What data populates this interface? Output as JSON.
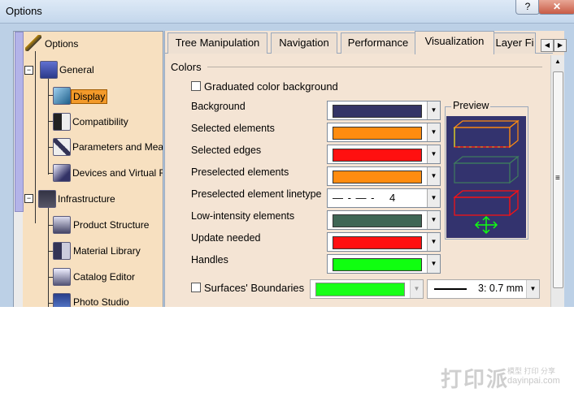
{
  "window": {
    "title": "Options",
    "help_label": "?",
    "close_label": "✕"
  },
  "tree": {
    "items": [
      {
        "label": "Options",
        "icon": "options-icon"
      },
      {
        "label": "General",
        "icon": "general-icon"
      },
      {
        "label": "Display",
        "icon": "display-icon",
        "selected": true
      },
      {
        "label": "Compatibility",
        "icon": "compatibility-icon"
      },
      {
        "label": "Parameters and Meas",
        "icon": "parameters-icon"
      },
      {
        "label": "Devices and Virtual R",
        "icon": "devices-icon"
      },
      {
        "label": "Infrastructure",
        "icon": "infrastructure-icon"
      },
      {
        "label": "Product Structure",
        "icon": "product-structure-icon"
      },
      {
        "label": "Material Library",
        "icon": "material-library-icon"
      },
      {
        "label": "Catalog Editor",
        "icon": "catalog-editor-icon"
      },
      {
        "label": "Photo Studio",
        "icon": "photo-studio-icon"
      }
    ]
  },
  "tabs": [
    {
      "label": "Tree Manipulation"
    },
    {
      "label": "Navigation"
    },
    {
      "label": "Performance"
    },
    {
      "label": "Visualization",
      "active": true
    },
    {
      "label": "Layer Fi"
    }
  ],
  "colors": {
    "section_label": "Colors",
    "graduated_label": "Graduated color background",
    "graduated_checked": false,
    "rows": [
      {
        "label": "Background",
        "color": "#343466"
      },
      {
        "label": "Selected elements",
        "color": "#ff8c10"
      },
      {
        "label": "Selected edges",
        "color": "#ff1010"
      },
      {
        "label": "Preselected elements",
        "color": "#ff8c10"
      },
      {
        "label": "Preselected element linetype",
        "linetype": "— - — -",
        "value": "4"
      },
      {
        "label": "Low-intensity elements",
        "color": "#3f6655"
      },
      {
        "label": "Update needed",
        "color": "#ff1010"
      },
      {
        "label": "Handles",
        "color": "#10ff10"
      }
    ],
    "preview_label": "Preview",
    "surfaces_label": "Surfaces' Boundaries",
    "surfaces_checked": false,
    "surfaces_color": "#18ff18",
    "thickness_value": "3: 0.7 mm"
  },
  "watermark": {
    "big": "打印派",
    "small": "模型 打印 分享",
    "url": "dayinpai.com"
  }
}
